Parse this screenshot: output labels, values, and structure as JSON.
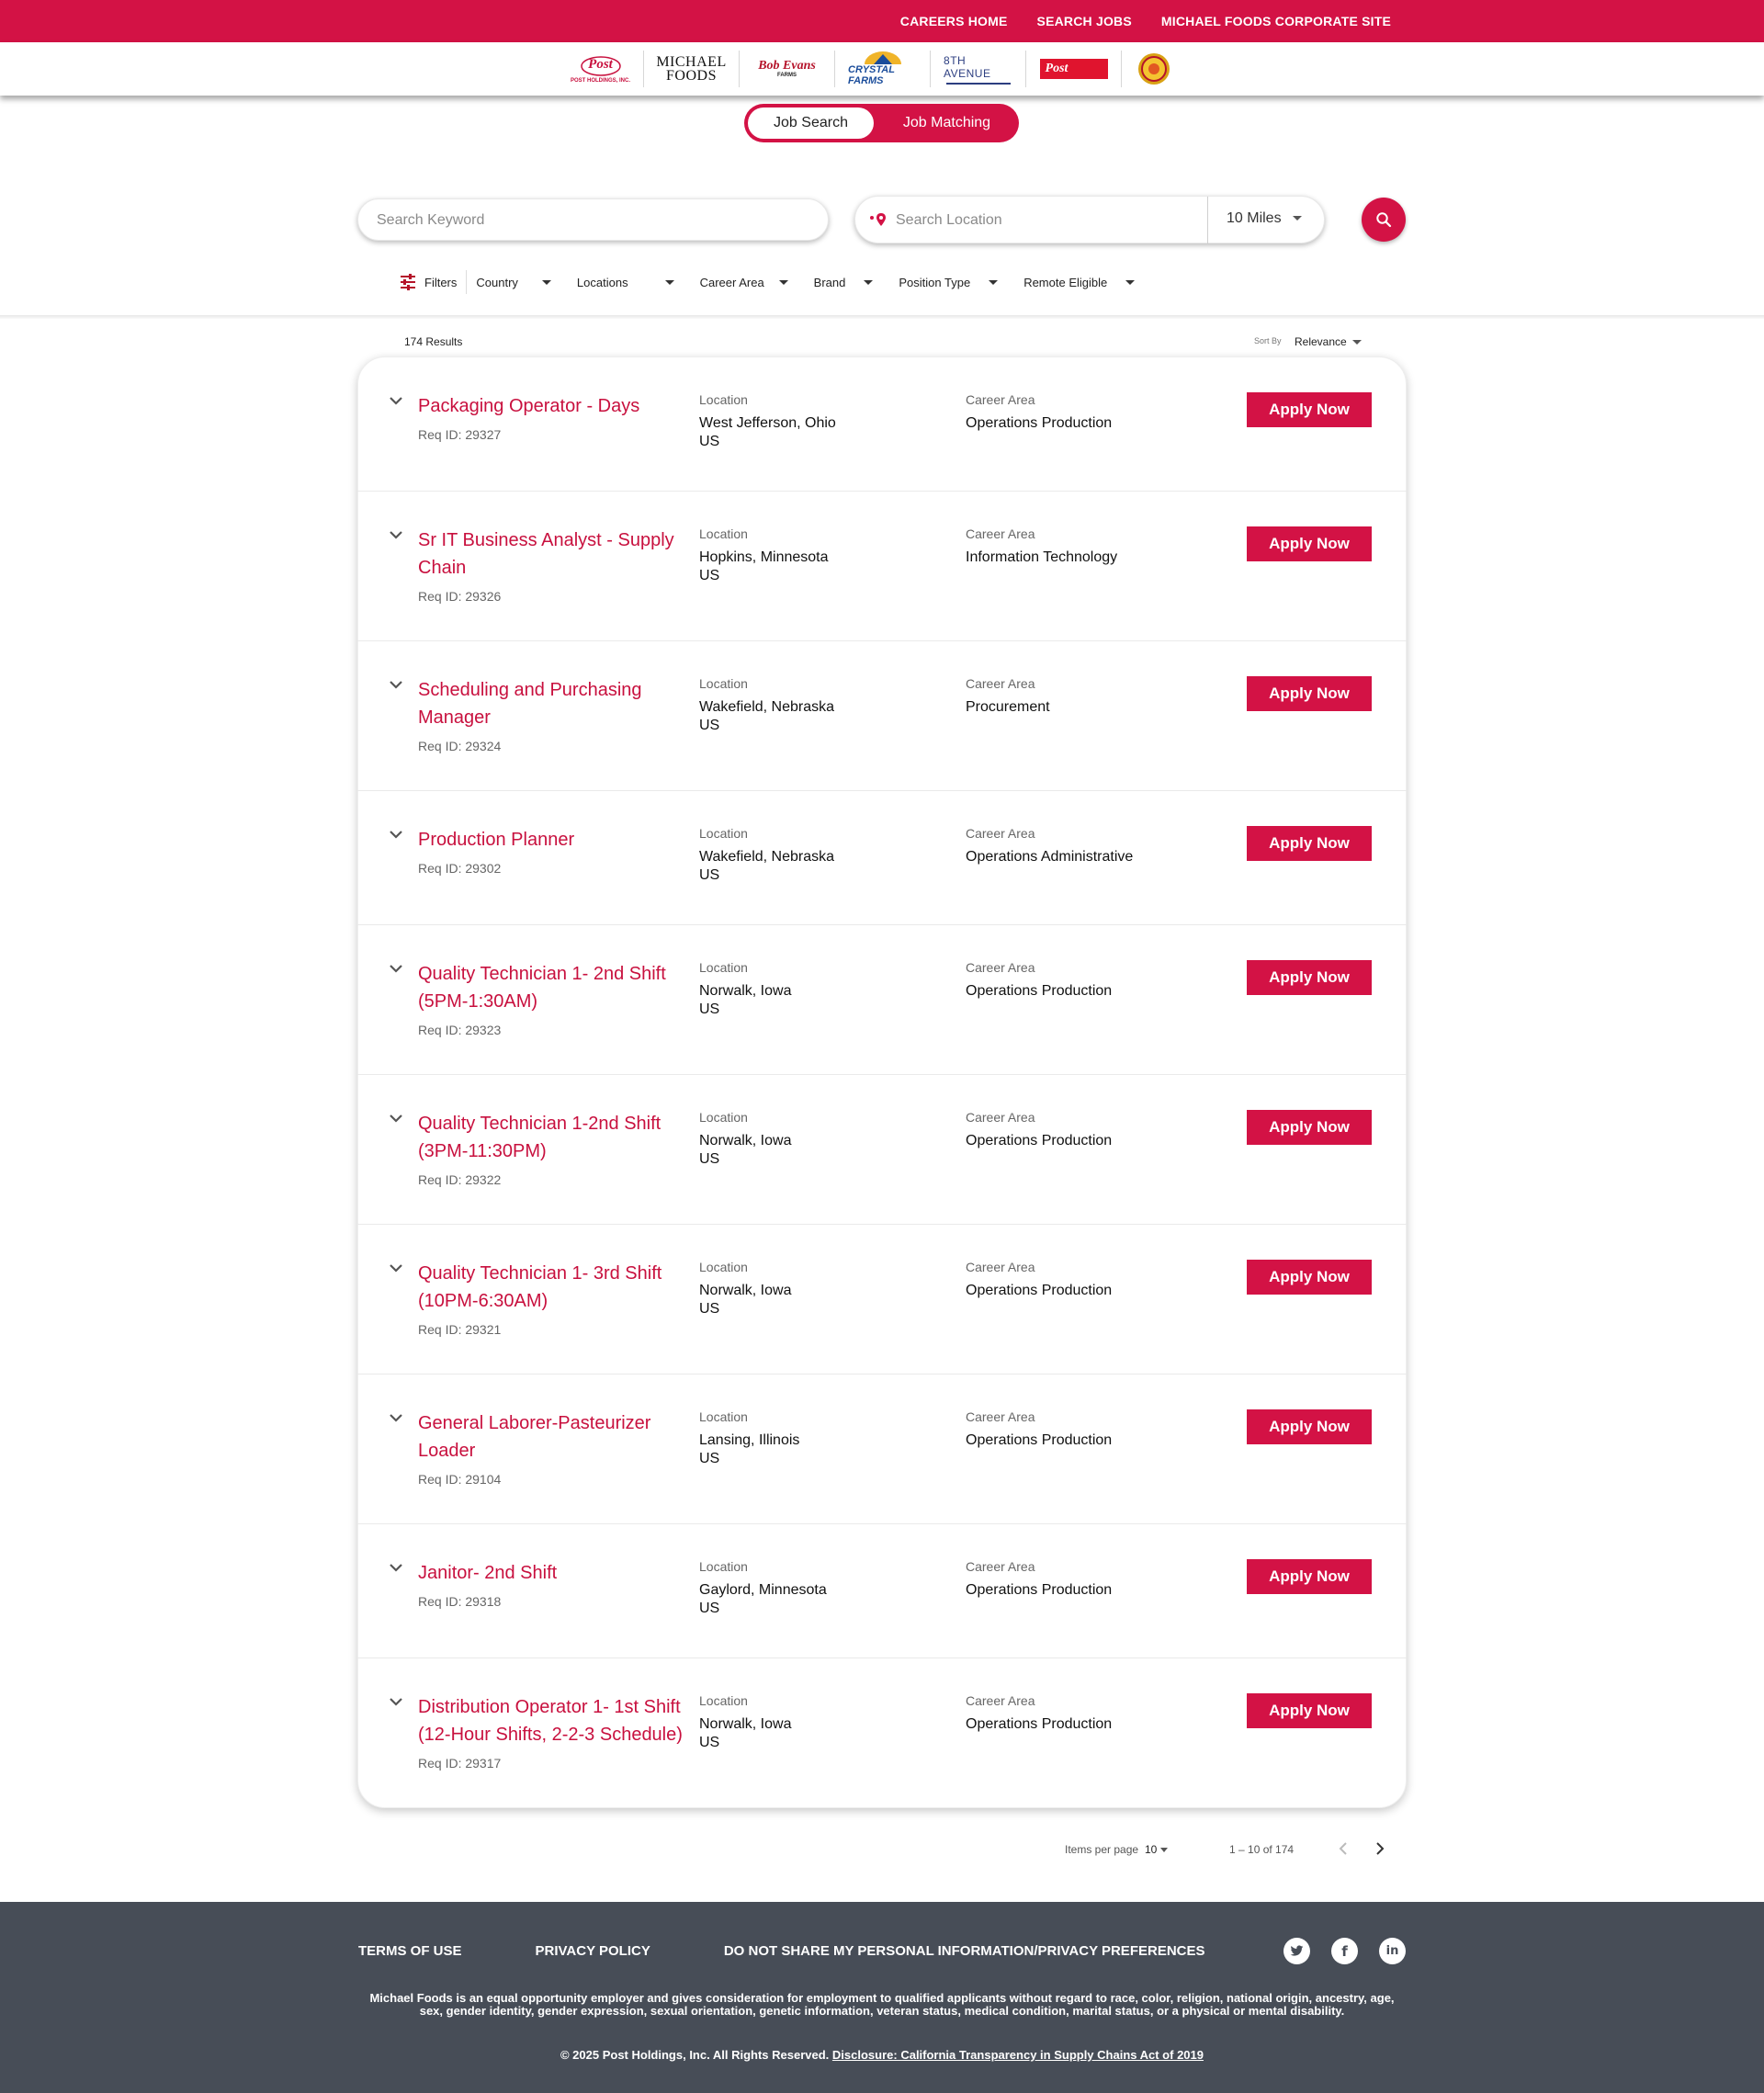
{
  "topnav": {
    "items": [
      "CAREERS HOME",
      "SEARCH JOBS",
      "MICHAEL FOODS CORPORATE SITE"
    ]
  },
  "brands": {
    "post_holdings": "Post",
    "post_holdings_sub": "POST HOLDINGS, INC.",
    "michael_foods_line1": "MICHAEL",
    "michael_foods_line2": "FOODS",
    "bob_evans": "Bob Evans",
    "bob_evans_sub": "FARMS",
    "crystal_farms": "CRYSTAL FARMS",
    "eighth_avenue": "8TH AVENUE",
    "post_consumer": "Post"
  },
  "toggle": {
    "job_search": "Job Search",
    "job_matching": "Job Matching"
  },
  "search": {
    "keyword_placeholder": "Search Keyword",
    "location_placeholder": "Search Location",
    "radius": "10 Miles"
  },
  "filters": {
    "label": "Filters",
    "items": [
      "Country",
      "Locations",
      "Career Area",
      "Brand",
      "Position Type",
      "Remote Eligible"
    ]
  },
  "results": {
    "count": "174 Results",
    "sort_by_label": "Sort By",
    "sort_by_value": "Relevance"
  },
  "labels": {
    "location": "Location",
    "career_area": "Career Area",
    "apply": "Apply Now"
  },
  "jobs": [
    {
      "title": "Packaging Operator - Days",
      "req": "Req ID: 29327",
      "city": "West Jefferson, Ohio",
      "country": "US",
      "area": "Operations Production"
    },
    {
      "title": "Sr IT Business Analyst - Supply Chain",
      "req": "Req ID: 29326",
      "city": "Hopkins, Minnesota",
      "country": "US",
      "area": "Information Technology"
    },
    {
      "title": "Scheduling and Purchasing Manager",
      "req": "Req ID: 29324",
      "city": "Wakefield, Nebraska",
      "country": "US",
      "area": "Procurement"
    },
    {
      "title": "Production Planner",
      "req": "Req ID: 29302",
      "city": "Wakefield, Nebraska",
      "country": "US",
      "area": "Operations Administrative"
    },
    {
      "title": "Quality Technician 1- 2nd Shift (5PM-1:30AM)",
      "req": "Req ID: 29323",
      "city": "Norwalk, Iowa",
      "country": "US",
      "area": "Operations Production"
    },
    {
      "title": "Quality Technician 1-2nd Shift (3PM-11:30PM)",
      "req": "Req ID: 29322",
      "city": "Norwalk, Iowa",
      "country": "US",
      "area": "Operations Production"
    },
    {
      "title": "Quality Technician 1- 3rd Shift (10PM-6:30AM)",
      "req": "Req ID: 29321",
      "city": "Norwalk, Iowa",
      "country": "US",
      "area": "Operations Production"
    },
    {
      "title": "General Laborer-Pasteurizer Loader",
      "req": "Req ID: 29104",
      "city": "Lansing, Illinois",
      "country": "US",
      "area": "Operations Production"
    },
    {
      "title": "Janitor- 2nd Shift",
      "req": "Req ID: 29318",
      "city": "Gaylord, Minnesota",
      "country": "US",
      "area": "Operations Production"
    },
    {
      "title": "Distribution Operator 1- 1st Shift (12-Hour Shifts, 2-2-3 Schedule)",
      "req": "Req ID: 29317",
      "city": "Norwalk, Iowa",
      "country": "US",
      "area": "Operations Production"
    }
  ],
  "paginator": {
    "items_per_page_label": "Items per page",
    "items_per_page": "10",
    "range": "1 – 10 of 174"
  },
  "footer": {
    "links": [
      "TERMS OF USE",
      "PRIVACY POLICY",
      "DO NOT SHARE MY PERSONAL INFORMATION/PRIVACY PREFERENCES"
    ],
    "social": [
      "twitter-icon",
      "facebook-icon",
      "linkedin-icon"
    ],
    "disclaimer": "Michael Foods is an equal opportunity employer and gives consideration for employment to qualified applicants without regard to race, color, religion, national origin, ancestry, age, sex, gender identity, gender expression, sexual orientation, genetic information, veteran status, medical condition, marital status, or a physical or mental disability.",
    "copyright": "© 2025 Post Holdings, Inc. All Rights Reserved.",
    "disclosure": "Disclosure: California Transparency in Supply Chains Act of 2019"
  },
  "colors": {
    "brand_red": "#d31245",
    "title_red": "#c8103e",
    "footer_bg": "#474d57"
  }
}
